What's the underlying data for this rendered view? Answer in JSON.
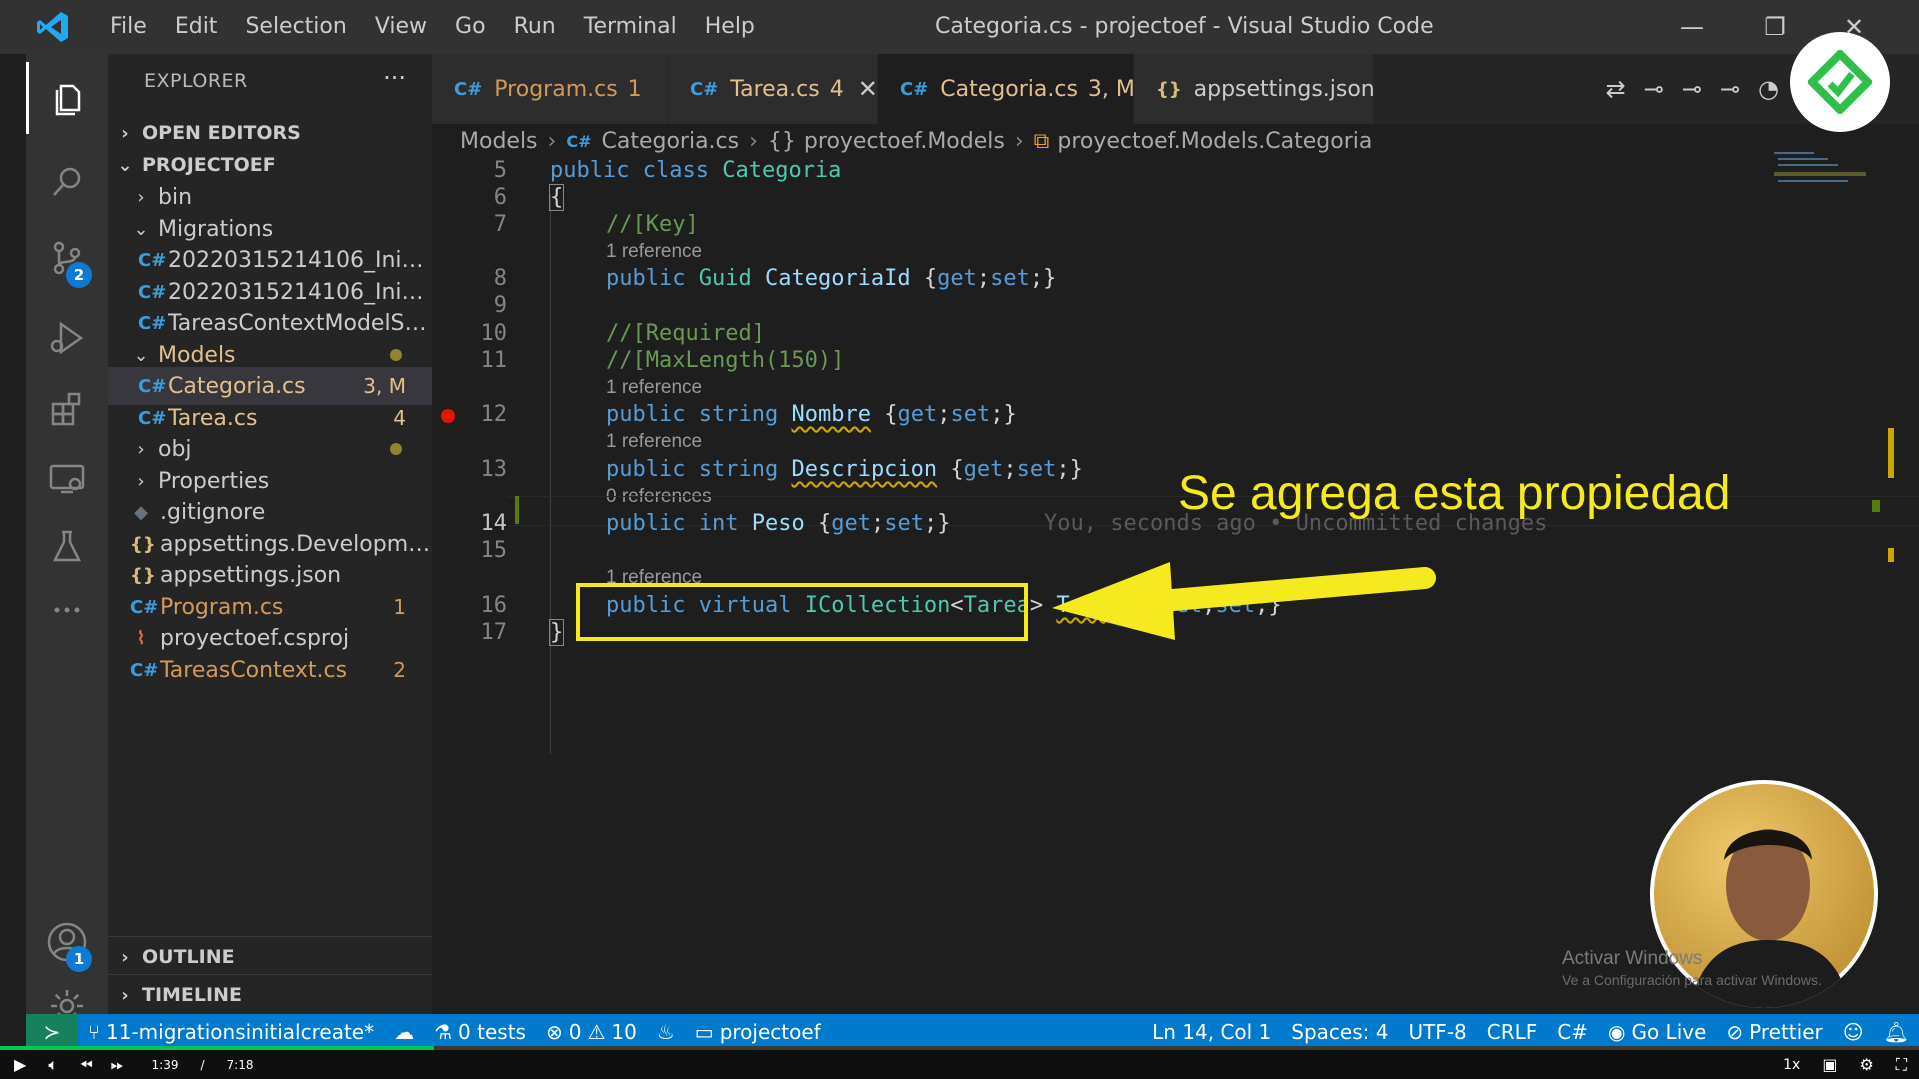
{
  "window": {
    "title": "Categoria.cs - projectoef - Visual Studio Code",
    "minimize": "—",
    "maximize": "❐",
    "close": "✕"
  },
  "menu": [
    "File",
    "Edit",
    "Selection",
    "View",
    "Go",
    "Run",
    "Terminal",
    "Help"
  ],
  "activity_bar": {
    "items": [
      {
        "icon": "files-icon"
      },
      {
        "icon": "search-icon"
      },
      {
        "icon": "source-control-icon",
        "badge": "2"
      },
      {
        "icon": "run-debug-icon"
      },
      {
        "icon": "extensions-icon"
      },
      {
        "icon": "remote-explorer-icon"
      },
      {
        "icon": "testing-icon"
      },
      {
        "icon": "more-icon"
      }
    ],
    "accounts_badge": "1"
  },
  "sidebar": {
    "title": "EXPLORER",
    "more": "···",
    "open_editors": "OPEN EDITORS",
    "project": "PROJECTOEF",
    "tree": [
      {
        "label": "bin",
        "type": "folder-closed"
      },
      {
        "label": "Migrations",
        "type": "folder-open"
      },
      {
        "label": "20220315214106_Initia...",
        "type": "cs"
      },
      {
        "label": "20220315214106_Initia...",
        "type": "cs"
      },
      {
        "label": "TareasContextModelSn...",
        "type": "cs"
      },
      {
        "label": "Models",
        "type": "folder-open",
        "dot": true
      },
      {
        "label": "Categoria.cs",
        "type": "cs",
        "meta": "3, M"
      },
      {
        "label": "Tarea.cs",
        "type": "cs",
        "meta": "4"
      },
      {
        "label": "obj",
        "type": "folder-closed",
        "dot": true
      },
      {
        "label": "Properties",
        "type": "folder-closed"
      },
      {
        "label": ".gitignore",
        "type": "git"
      },
      {
        "label": "appsettings.Developme...",
        "type": "json"
      },
      {
        "label": "appsettings.json",
        "type": "json"
      },
      {
        "label": "Program.cs",
        "type": "cs",
        "meta": "1"
      },
      {
        "label": "proyectoef.csproj",
        "type": "rss"
      },
      {
        "label": "TareasContext.cs",
        "type": "cs",
        "meta": "2"
      }
    ],
    "outline": "OUTLINE",
    "timeline": "TIMELINE"
  },
  "tabs": [
    {
      "label": "Program.cs",
      "badge": "1"
    },
    {
      "label": "Tarea.cs",
      "badge": "4"
    },
    {
      "label": "Categoria.cs",
      "badge": "3, M"
    },
    {
      "label": "appsettings.json",
      "badge": ""
    }
  ],
  "breadcrumb": [
    "Models",
    "Categoria.cs",
    "proyectoef.Models",
    "proyectoef.Models.Categoria"
  ],
  "code": {
    "lines": [
      "5",
      "6",
      "7",
      "8",
      "9",
      "10",
      "11",
      "12",
      "13",
      "14",
      "15",
      "16",
      "17"
    ],
    "lens": [
      "1 reference",
      "1 reference",
      "1 reference",
      "0 references",
      "1 reference"
    ],
    "line5": [
      "public",
      "class",
      "Categoria"
    ],
    "line6": "{",
    "line7": "//[Key]",
    "line8": [
      "public",
      "Guid",
      "CategoriaId",
      "{",
      "get",
      ";",
      "set",
      ";}"
    ],
    "line10": "//[Required]",
    "line11": "//[MaxLength(150)]",
    "line12": [
      "public",
      "string",
      "Nombre",
      "{",
      "get",
      ";",
      "set",
      ";}"
    ],
    "line13": [
      "public",
      "string",
      "Descripcion",
      "{",
      "get",
      ";",
      "set",
      ";}"
    ],
    "line14": [
      "public",
      "int",
      "Peso",
      "{",
      "get",
      ";",
      "set",
      ";}"
    ],
    "line14_ghost": "You, seconds ago • Uncommitted changes",
    "line16": [
      "public",
      "virtual",
      "ICollection",
      "<",
      "Tarea",
      ">",
      "Tareas",
      "{",
      "get",
      ";",
      "set",
      ";}"
    ],
    "line17": "}"
  },
  "annotation": "Se agrega esta propiedad",
  "watermark": {
    "line1": "Activar Windows",
    "line2": "Ve a Configuración para activar Windows."
  },
  "statusbar": {
    "branch": "11-migrationsinitialcreate*",
    "tests": "0 tests",
    "errors": "0",
    "warnings": "10",
    "project": "projectoef",
    "position": "Ln 14, Col 1",
    "spaces": "Spaces: 4",
    "encoding": "UTF-8",
    "eol": "CRLF",
    "language": "C#",
    "golive": "Go Live",
    "prettier": "Prettier"
  },
  "player": {
    "current": "1:39",
    "separator": "/",
    "duration": "7:18",
    "speed": "1x",
    "progress": 0.226
  },
  "colors": {
    "accent": "#007acc",
    "annotation": "#f5ea1e"
  }
}
